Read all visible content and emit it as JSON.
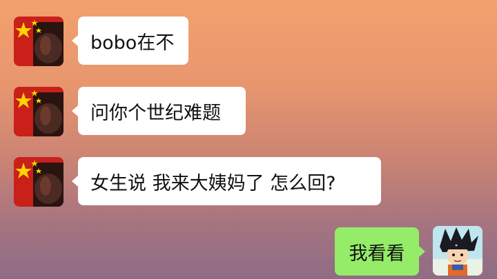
{
  "messages": [
    {
      "sender": "other",
      "text": "bobo在不"
    },
    {
      "sender": "other",
      "text": "问你个世纪难题"
    },
    {
      "sender": "other",
      "text": "女生说 我来大姨妈了 怎么回?"
    },
    {
      "sender": "self",
      "text": "我看看"
    }
  ],
  "colors": {
    "incoming_bubble": "#ffffff",
    "outgoing_bubble": "#95ec69"
  },
  "icons": {
    "other_avatar": "flag-avatar-icon",
    "self_avatar": "anime-boy-avatar-icon"
  }
}
